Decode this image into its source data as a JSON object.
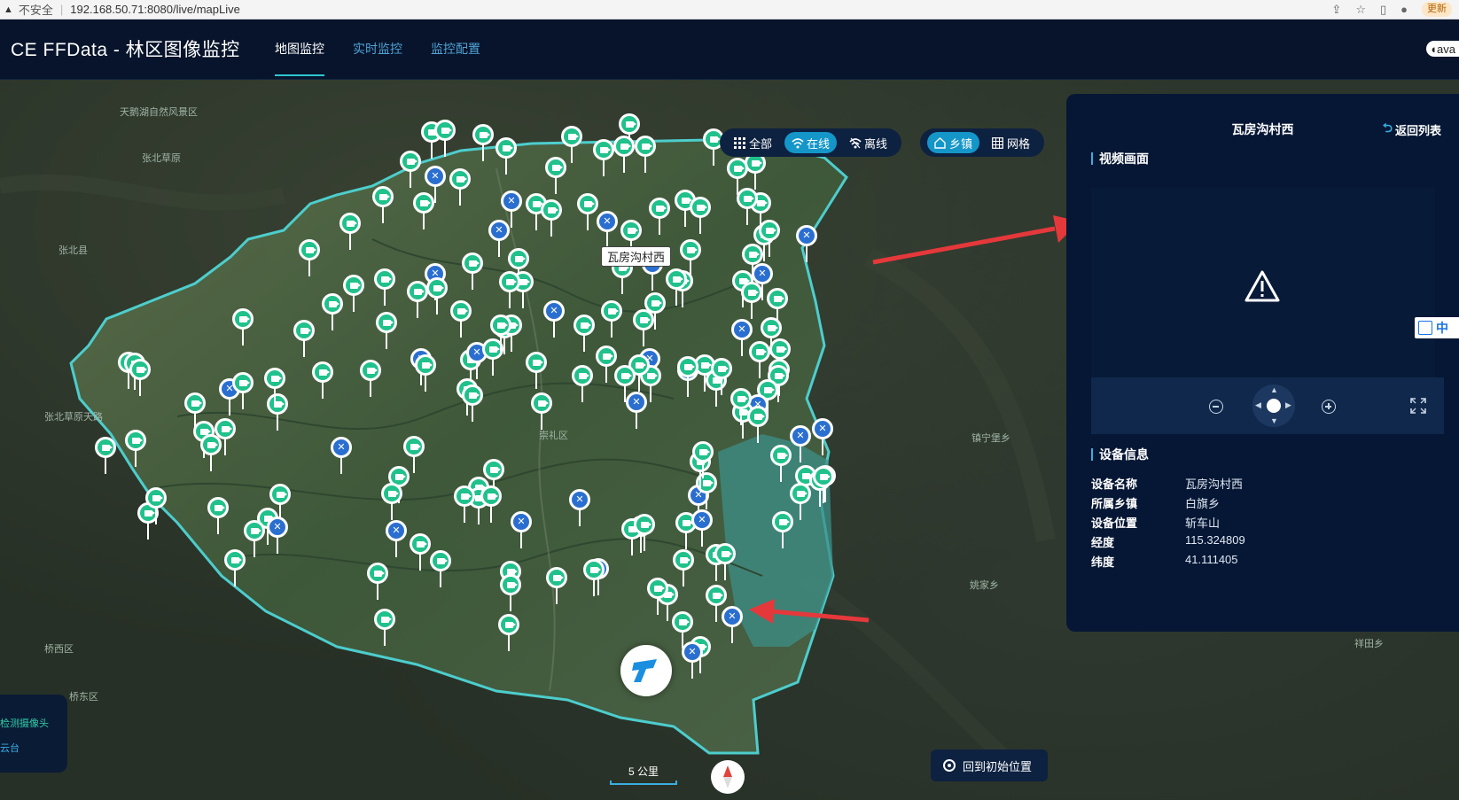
{
  "browser": {
    "insecure_label": "不安全",
    "url": "192.168.50.71:8080/live/mapLive",
    "update_label": "更新"
  },
  "header": {
    "title": "CE FFData - 林区图像监控",
    "nav": [
      "地图监控",
      "实时监控",
      "监控配置"
    ],
    "user": "ava"
  },
  "map": {
    "places": [
      {
        "name": "天鹅湖自然风景区",
        "style": "light"
      },
      {
        "name": "张北草原",
        "style": "light"
      },
      {
        "name": "张北县",
        "style": "light"
      },
      {
        "name": "张北草原天路",
        "style": "light"
      },
      {
        "name": "崇礼区",
        "style": "light"
      },
      {
        "name": "镇宁堡乡",
        "style": "light"
      },
      {
        "name": "姚家乡",
        "style": "light"
      },
      {
        "name": "祥田乡",
        "style": "light"
      },
      {
        "name": "桥西区",
        "style": "light"
      },
      {
        "name": "桥东区",
        "style": "light"
      }
    ],
    "selected_label": "瓦房沟村西",
    "filters": {
      "all": "全部",
      "online": "在线",
      "offline": "离线",
      "town": "乡镇",
      "grid": "网格"
    },
    "legend": {
      "item1": "检测摄像头",
      "item2": "云台"
    },
    "reset_label": "回到初始位置",
    "scale_label": "5 公里",
    "colors": {
      "online": "#20c18a",
      "offline": "#2a6fd0",
      "boundary": "#4fd6d6",
      "accent": "#1496c9",
      "arrow": "#e5383b"
    }
  },
  "panel": {
    "title": "瓦房沟村西",
    "back_label": "返回列表",
    "video_section": "视频画面",
    "info_section": "设备信息",
    "side_chip": "中",
    "info": [
      {
        "k": "设备名称",
        "v": "瓦房沟村西"
      },
      {
        "k": "所属乡镇",
        "v": "白旗乡"
      },
      {
        "k": "设备位置",
        "v": "斩车山"
      },
      {
        "k": "经度",
        "v": "115.324809"
      },
      {
        "k": "纬度",
        "v": "41.111405"
      }
    ]
  }
}
